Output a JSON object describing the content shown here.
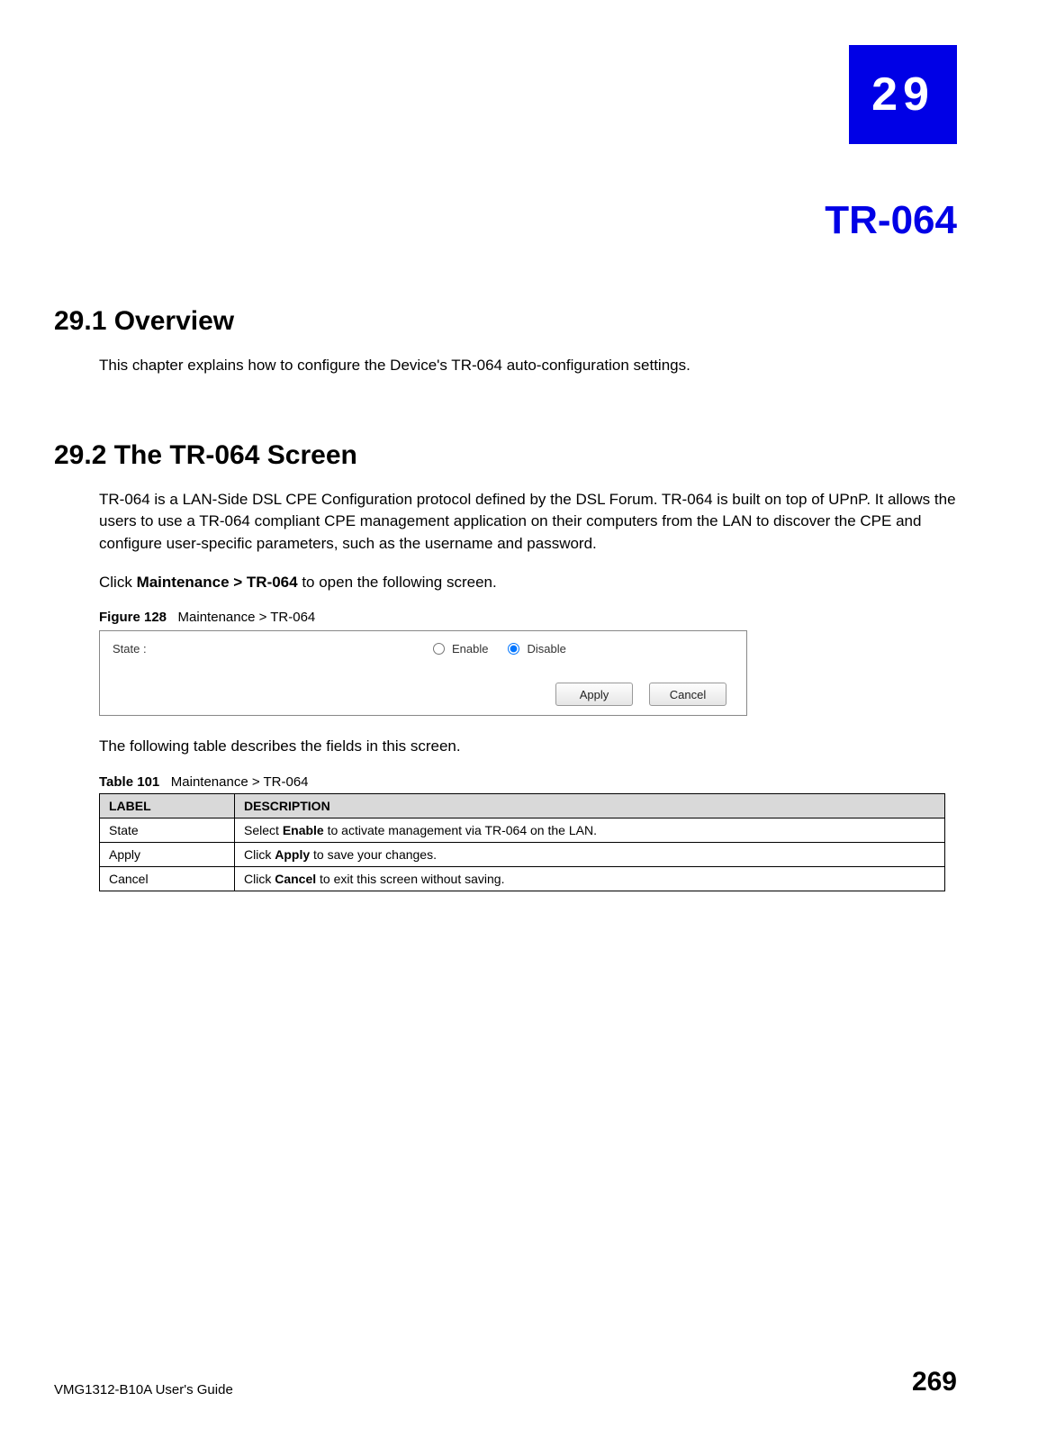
{
  "chapter": {
    "number": "29",
    "title": "TR-064"
  },
  "sections": {
    "overview": {
      "heading": "29.1  Overview",
      "body": "This chapter explains how to configure the Device's TR-064 auto-configuration settings."
    },
    "screen": {
      "heading": "29.2  The TR-064 Screen",
      "body1": "TR-064 is a LAN-Side DSL CPE Configuration protocol defined by the DSL Forum. TR-064 is built on top of UPnP. It allows the users to use a TR-064 compliant CPE management application on their computers from the LAN to discover the CPE and configure user-specific parameters, such as the username and password.",
      "body2_pre": "Click ",
      "body2_bold": "Maintenance > TR-064",
      "body2_post": " to open the following screen.",
      "body3": "The following table describes the fields in this screen."
    }
  },
  "figure": {
    "label": "Figure 128",
    "caption": "Maintenance > TR-064",
    "screenshot": {
      "state_label": "State :",
      "enable_label": "Enable",
      "disable_label": "Disable",
      "selected": "Disable",
      "apply_button": "Apply",
      "cancel_button": "Cancel"
    }
  },
  "table": {
    "label": "Table 101",
    "caption": "Maintenance > TR-064",
    "headers": {
      "label": "LABEL",
      "description": "DESCRIPTION"
    },
    "rows": [
      {
        "label": "State",
        "desc_pre": "Select ",
        "desc_bold": "Enable",
        "desc_post": " to activate management via TR-064 on the LAN."
      },
      {
        "label": "Apply",
        "desc_pre": "Click ",
        "desc_bold": "Apply",
        "desc_post": " to save your changes."
      },
      {
        "label": "Cancel",
        "desc_pre": "Click ",
        "desc_bold": "Cancel",
        "desc_post": " to exit this screen without saving."
      }
    ]
  },
  "footer": {
    "guide": "VMG1312-B10A User's Guide",
    "page": "269"
  }
}
